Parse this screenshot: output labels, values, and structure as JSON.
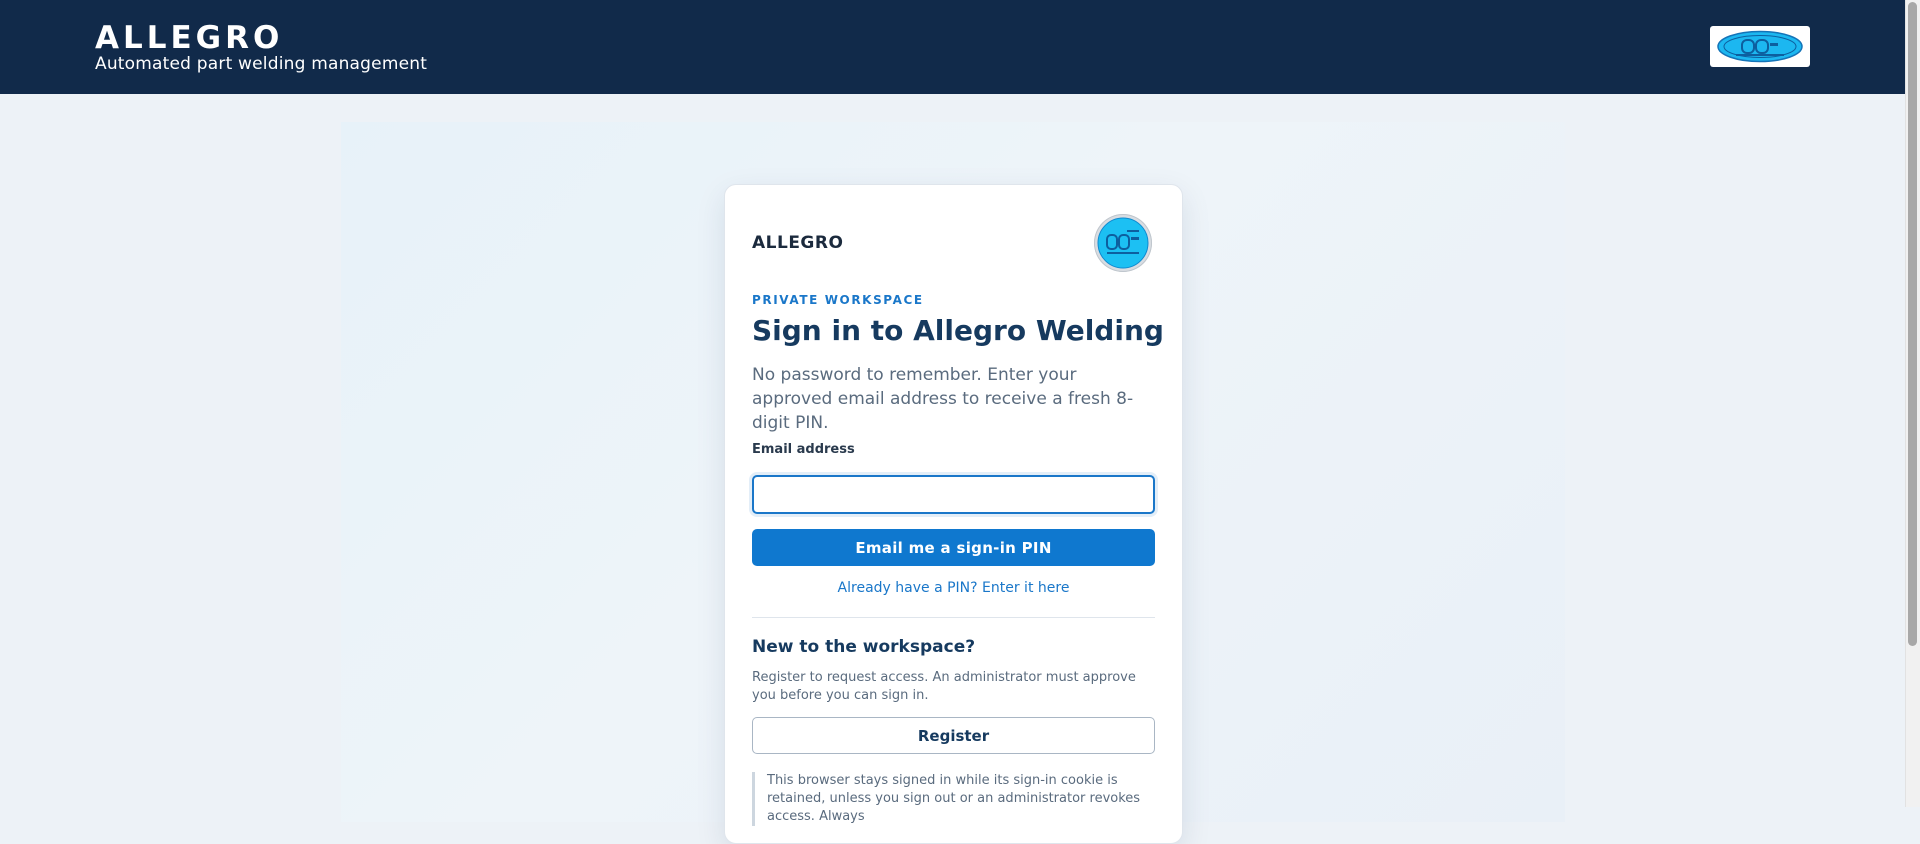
{
  "header": {
    "title": "ALLEGRO",
    "subtitle": "Automated part welding management",
    "logo_icon": "company-logo-icon"
  },
  "card": {
    "brand": "ALLEGRO",
    "logo_icon": "company-badge-icon",
    "eyebrow": "PRIVATE WORKSPACE",
    "heading": "Sign in to Allegro Welding",
    "lead": "No password to remember. Enter your approved email address to receive a fresh 8-digit PIN.",
    "email_label": "Email address",
    "email_value": "",
    "email_placeholder": "",
    "submit_label": "Email me a sign-in PIN",
    "pin_link": "Already have a PIN? Enter it here",
    "register_title": "New to the workspace?",
    "register_text": "Register to request access. An administrator must approve you before you can sign in.",
    "register_label": "Register",
    "notice": "This browser stays signed in while its sign-in cookie is retained, unless you sign out or an administrator revokes access. Always"
  },
  "colors": {
    "header_bg": "#112a4a",
    "accent": "#0f78cf",
    "heading": "#163a5f"
  }
}
